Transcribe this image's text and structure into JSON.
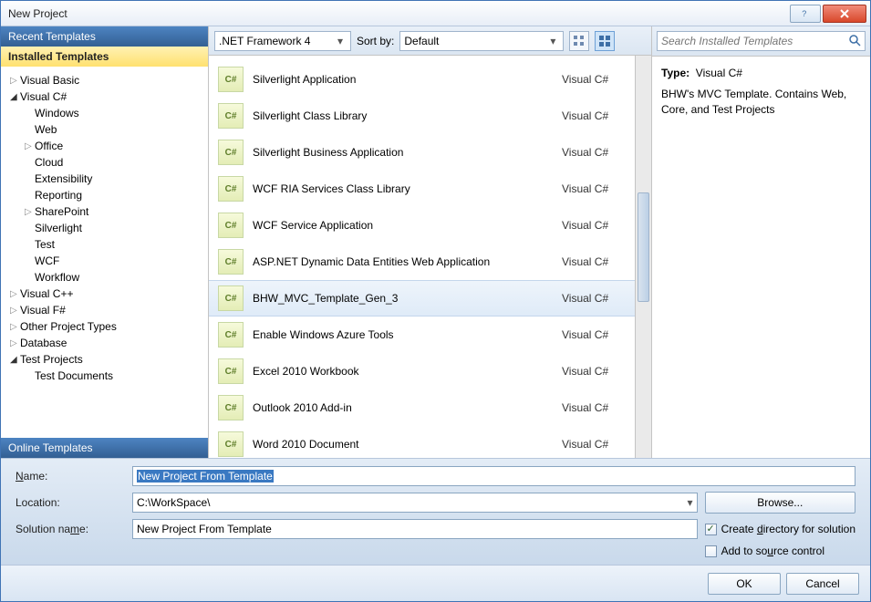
{
  "window": {
    "title": "New Project"
  },
  "sidebar": {
    "recent_header": "Recent Templates",
    "installed_header": "Installed Templates",
    "online_header": "Online Templates",
    "tree": [
      {
        "label": "Visual Basic",
        "level": 0,
        "arrow": "collapsed"
      },
      {
        "label": "Visual C#",
        "level": 0,
        "arrow": "expanded"
      },
      {
        "label": "Windows",
        "level": 1,
        "arrow": "none"
      },
      {
        "label": "Web",
        "level": 1,
        "arrow": "none"
      },
      {
        "label": "Office",
        "level": 1,
        "arrow": "collapsed"
      },
      {
        "label": "Cloud",
        "level": 1,
        "arrow": "none"
      },
      {
        "label": "Extensibility",
        "level": 1,
        "arrow": "none"
      },
      {
        "label": "Reporting",
        "level": 1,
        "arrow": "none"
      },
      {
        "label": "SharePoint",
        "level": 1,
        "arrow": "collapsed"
      },
      {
        "label": "Silverlight",
        "level": 1,
        "arrow": "none"
      },
      {
        "label": "Test",
        "level": 1,
        "arrow": "none"
      },
      {
        "label": "WCF",
        "level": 1,
        "arrow": "none"
      },
      {
        "label": "Workflow",
        "level": 1,
        "arrow": "none"
      },
      {
        "label": "Visual C++",
        "level": 0,
        "arrow": "collapsed"
      },
      {
        "label": "Visual F#",
        "level": 0,
        "arrow": "collapsed"
      },
      {
        "label": "Other Project Types",
        "level": 0,
        "arrow": "collapsed"
      },
      {
        "label": "Database",
        "level": 0,
        "arrow": "collapsed"
      },
      {
        "label": "Test Projects",
        "level": 0,
        "arrow": "expanded"
      },
      {
        "label": "Test Documents",
        "level": 1,
        "arrow": "none"
      }
    ]
  },
  "toolbar": {
    "framework": ".NET Framework 4",
    "sortby_label": "Sort by:",
    "sortby_value": "Default"
  },
  "templates": [
    {
      "name": "Silverlight Application",
      "lang": "Visual C#",
      "selected": false
    },
    {
      "name": "Silverlight Class Library",
      "lang": "Visual C#",
      "selected": false
    },
    {
      "name": "Silverlight Business Application",
      "lang": "Visual C#",
      "selected": false
    },
    {
      "name": "WCF RIA Services Class Library",
      "lang": "Visual C#",
      "selected": false
    },
    {
      "name": "WCF Service Application",
      "lang": "Visual C#",
      "selected": false
    },
    {
      "name": "ASP.NET Dynamic Data Entities Web Application",
      "lang": "Visual C#",
      "selected": false
    },
    {
      "name": "BHW_MVC_Template_Gen_3",
      "lang": "Visual C#",
      "selected": true
    },
    {
      "name": "Enable Windows Azure Tools",
      "lang": "Visual C#",
      "selected": false
    },
    {
      "name": "Excel 2010 Workbook",
      "lang": "Visual C#",
      "selected": false
    },
    {
      "name": "Outlook 2010 Add-in",
      "lang": "Visual C#",
      "selected": false
    },
    {
      "name": "Word 2010 Document",
      "lang": "Visual C#",
      "selected": false
    }
  ],
  "search": {
    "placeholder": "Search Installed Templates"
  },
  "details": {
    "type_label": "Type:",
    "type_value": "Visual C#",
    "description": "BHW's MVC Template. Contains Web, Core, and Test Projects"
  },
  "form": {
    "name_label": "Name:",
    "name_value": "New Project From Template",
    "location_label": "Location:",
    "location_value": "C:\\WorkSpace\\",
    "solution_label": "Solution name:",
    "solution_value": "New Project From Template",
    "browse": "Browse...",
    "create_dir": "Create directory for solution",
    "add_source": "Add to source control"
  },
  "footer": {
    "ok": "OK",
    "cancel": "Cancel"
  }
}
